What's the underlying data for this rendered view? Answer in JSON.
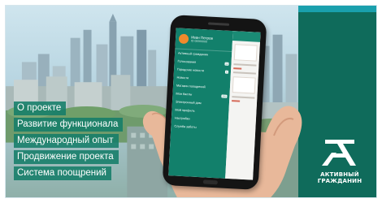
{
  "menu": {
    "items": [
      "О проекте",
      "Развитие функционала",
      "Международный опыт",
      "Продвижение проекта",
      "Система поощрений"
    ]
  },
  "logo": {
    "line1": "АКТИВНЫЙ",
    "line2": "ГРАЖДАНИН"
  },
  "phone": {
    "user_name": "Иван Петров",
    "user_sub": "ID 00000000",
    "drawer_items": [
      {
        "label": "Активный гражданин",
        "badge": ""
      },
      {
        "label": "Голосования",
        "badge": "12"
      },
      {
        "label": "Городские новости",
        "badge": "5"
      },
      {
        "label": "Новости",
        "badge": ""
      },
      {
        "label": "Магазин поощрений",
        "badge": ""
      },
      {
        "label": "Мои баллы",
        "badge": "250"
      },
      {
        "label": "Электронный дом",
        "badge": ""
      },
      {
        "label": "Мой профиль",
        "badge": ""
      },
      {
        "label": "Настройки",
        "badge": ""
      },
      {
        "label": "Служба заботы",
        "badge": ""
      }
    ]
  },
  "colors": {
    "brand_green": "#0f6b5b",
    "menu_green": "#147d69",
    "accent_teal": "#1aa0ad"
  }
}
